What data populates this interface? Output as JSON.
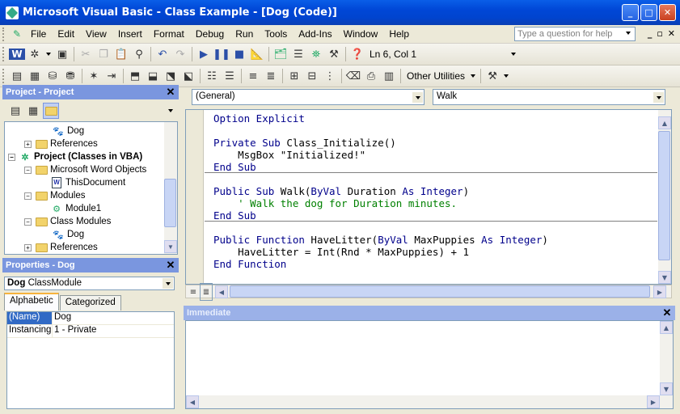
{
  "window": {
    "title": "Microsoft Visual Basic - Class Example - [Dog (Code)]",
    "minimize": "_",
    "maximize": "□",
    "close": "✕"
  },
  "menu": {
    "items": [
      "File",
      "Edit",
      "View",
      "Insert",
      "Format",
      "Debug",
      "Run",
      "Tools",
      "Add-Ins",
      "Window",
      "Help"
    ],
    "help_placeholder": "Type a question for help",
    "mdi": [
      "_",
      "▫",
      "✕"
    ]
  },
  "toolbar1": {
    "position_readout": "Ln 6, Col 1"
  },
  "toolbar2": {
    "other_utilities": "Other Utilities"
  },
  "project": {
    "title": "Project - Project",
    "tree": [
      {
        "label": "Dog",
        "type": "class"
      },
      {
        "label": "References",
        "type": "folder"
      },
      {
        "label": "Project (Classes in VBA)",
        "type": "project"
      },
      {
        "label": "Microsoft Word Objects",
        "type": "folder"
      },
      {
        "label": "ThisDocument",
        "type": "document"
      },
      {
        "label": "Modules",
        "type": "folder"
      },
      {
        "label": "Module1",
        "type": "module"
      },
      {
        "label": "Class Modules",
        "type": "folder"
      },
      {
        "label": "Dog",
        "type": "class"
      },
      {
        "label": "References",
        "type": "folder"
      }
    ]
  },
  "properties": {
    "title": "Properties - Dog",
    "object_name": "Dog",
    "object_type": "ClassModule",
    "tabs": [
      "Alphabetic",
      "Categorized"
    ],
    "rows": [
      {
        "name": "(Name)",
        "value": "Dog"
      },
      {
        "name": "Instancing",
        "value": "1 - Private"
      }
    ]
  },
  "code": {
    "object_combo": "(General)",
    "procedure_combo": "Walk",
    "lines": [
      "Option Explicit",
      "",
      "Private Sub Class_Initialize()",
      "    MsgBox \"Initialized!\"",
      "End Sub",
      "",
      "Public Sub Walk(ByVal Duration As Integer)",
      "    ' Walk the dog for Duration minutes.",
      "End Sub",
      "",
      "Public Function HaveLitter(ByVal MaxPuppies As Integer)",
      "    HaveLitter = Int(Rnd * MaxPuppies) + 1",
      "End Function"
    ]
  },
  "immediate": {
    "title": "Immediate"
  }
}
